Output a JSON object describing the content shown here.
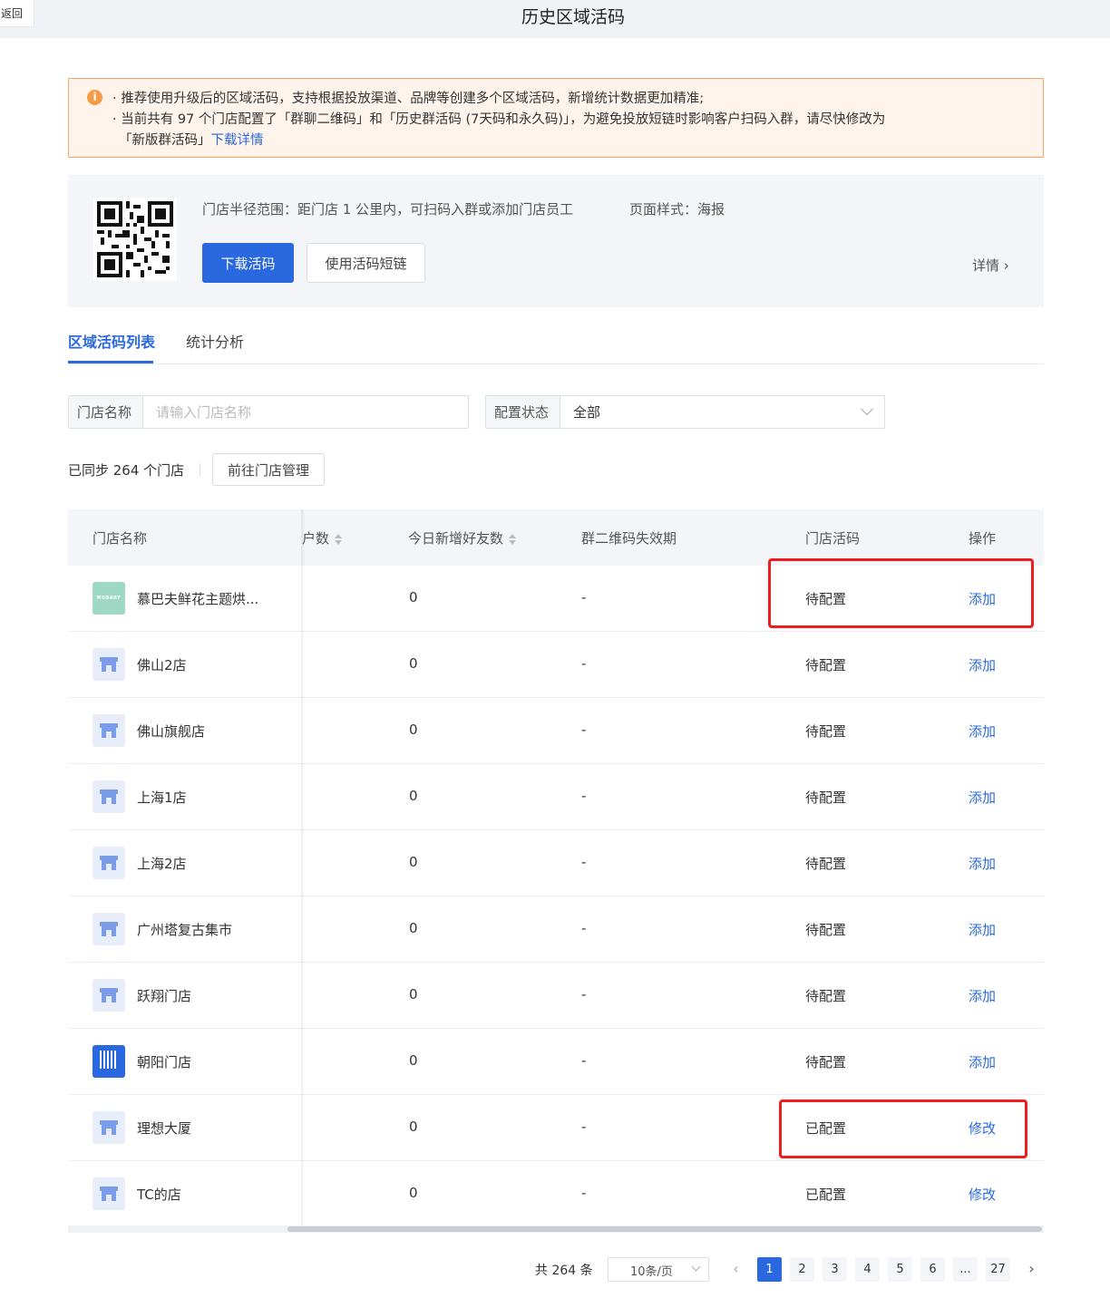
{
  "header": {
    "back_label": "返回",
    "title": "历史区域活码"
  },
  "notice": {
    "line1": "· 推荐使用升级后的区域活码，支持根据投放渠道、品牌等创建多个区域活码，新增统计数据更加精准;",
    "line2": "· 当前共有 97 个门店配置了「群聊二维码」和「历史群活码 (7天码和永久码)」，为避免投放短链时影响客户扫码入群，请尽快修改为",
    "line3_prefix": "「新版群活码」",
    "line3_link": "下载详情"
  },
  "qr_card": {
    "range_text": "门店半径范围：距门店 1 公里内，可扫码入群或添加门店员工",
    "style_text": "页面样式：海报",
    "download_label": "下载活码",
    "shortlink_label": "使用活码短链",
    "detail_label": "详情 ›"
  },
  "tabs": {
    "list": "区域活码列表",
    "stats": "统计分析"
  },
  "filters": {
    "store_label": "门店名称",
    "store_placeholder": "请输入门店名称",
    "status_label": "配置状态",
    "status_value": "全部"
  },
  "sync": {
    "text": "已同步 264 个门店",
    "manage_label": "前往门店管理"
  },
  "table": {
    "headers": {
      "name": "门店名称",
      "customers": "户数",
      "new_friends": "今日新增好友数",
      "expiry": "群二维码失效期",
      "code": "门店活码",
      "action": "操作"
    },
    "rows": [
      {
        "name": "慕巴夫鲜花主题烘...",
        "avatar": "MUBARF",
        "new_friends": "0",
        "expiry": "-",
        "status": "待配置",
        "action": "添加"
      },
      {
        "name": "佛山2店",
        "new_friends": "0",
        "expiry": "-",
        "status": "待配置",
        "action": "添加"
      },
      {
        "name": "佛山旗舰店",
        "new_friends": "0",
        "expiry": "-",
        "status": "待配置",
        "action": "添加"
      },
      {
        "name": "上海1店",
        "new_friends": "0",
        "expiry": "-",
        "status": "待配置",
        "action": "添加"
      },
      {
        "name": "上海2店",
        "new_friends": "0",
        "expiry": "-",
        "status": "待配置",
        "action": "添加"
      },
      {
        "name": "广州塔复古集市",
        "new_friends": "0",
        "expiry": "-",
        "status": "待配置",
        "action": "添加"
      },
      {
        "name": "跃翔门店",
        "new_friends": "0",
        "expiry": "-",
        "status": "待配置",
        "action": "添加"
      },
      {
        "name": "朝阳门店",
        "new_friends": "0",
        "expiry": "-",
        "status": "待配置",
        "action": "添加"
      },
      {
        "name": "理想大厦",
        "new_friends": "0",
        "expiry": "-",
        "status": "已配置",
        "action": "修改"
      },
      {
        "name": "TC的店",
        "new_friends": "0",
        "expiry": "-",
        "status": "已配置",
        "action": "修改"
      }
    ]
  },
  "pagination": {
    "total": "共 264 条",
    "page_size": "10条/页",
    "pages": [
      "1",
      "2",
      "3",
      "4",
      "5",
      "6",
      "...",
      "27"
    ],
    "current": "1",
    "prev": "‹",
    "next": "›"
  },
  "colors": {
    "primary": "#2a68e0",
    "warning_bg": "#fff4ec",
    "highlight": "#f01d1d"
  }
}
